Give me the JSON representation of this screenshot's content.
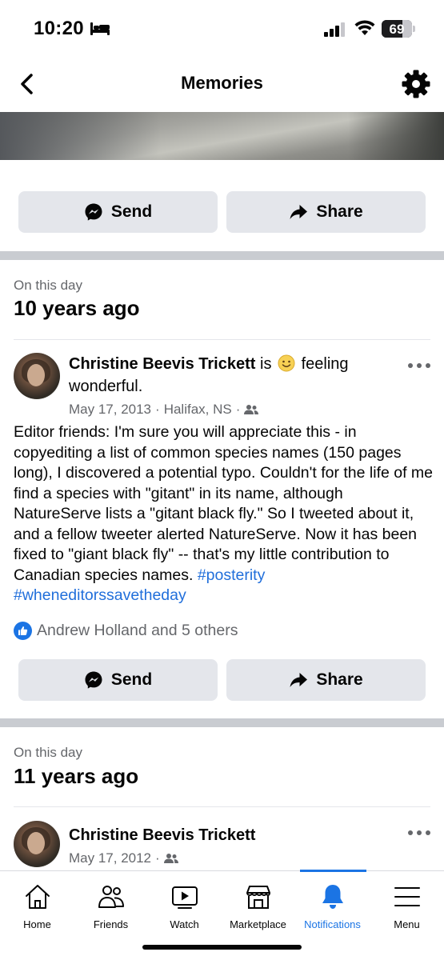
{
  "status_bar": {
    "time": "10:20",
    "battery": "69",
    "battery_level_percent": 69
  },
  "nav": {
    "title": "Memories",
    "back_icon": "chevron-left-icon",
    "settings_icon": "gear-icon"
  },
  "top_actions": {
    "send_label": "Send",
    "share_label": "Share"
  },
  "memories": [
    {
      "on_this_day_label": "On this day",
      "years_ago": "10 years ago",
      "post": {
        "author": "Christine Beevis Trickett",
        "is_text": "is",
        "feeling_text": "feeling",
        "feeling_value": "wonderful.",
        "date": "May 17, 2013",
        "separator": "·",
        "location": "Halifax, NS",
        "audience_icon": "friends-icon",
        "body": "Editor friends: I'm sure you will appreciate this - in copyediting a list of common species names (150 pages long), I discovered a potential typo. Couldn't for the life of me find a species with \"gitant\" in its name, although NatureServe lists a \"gitant black fly.\" So I tweeted about it, and a fellow tweeter alerted NatureServe. Now it has been fixed to \"giant black fly\" -- that's my little contribution to Canadian species names.",
        "hashtags": [
          "#posterity",
          "#wheneditorssavetheday"
        ],
        "reactions_text": "Andrew Holland and 5 others",
        "send_label": "Send",
        "share_label": "Share"
      }
    },
    {
      "on_this_day_label": "On this day",
      "years_ago": "11 years ago",
      "post": {
        "author": "Christine Beevis Trickett",
        "date": "May 17, 2012",
        "separator": "·",
        "audience_icon": "friends-icon"
      }
    }
  ],
  "tabs": [
    {
      "label": "Home",
      "icon": "home-icon"
    },
    {
      "label": "Friends",
      "icon": "friends-icon"
    },
    {
      "label": "Watch",
      "icon": "watch-icon"
    },
    {
      "label": "Marketplace",
      "icon": "marketplace-icon"
    },
    {
      "label": "Notifications",
      "icon": "bell-icon",
      "active": true
    },
    {
      "label": "Menu",
      "icon": "menu-icon"
    }
  ],
  "colors": {
    "accent": "#1b74e4",
    "hashtag": "#216fdb",
    "secondary_text": "#65676b",
    "button_bg": "#e4e6eb",
    "divider": "#c9ccd1"
  }
}
